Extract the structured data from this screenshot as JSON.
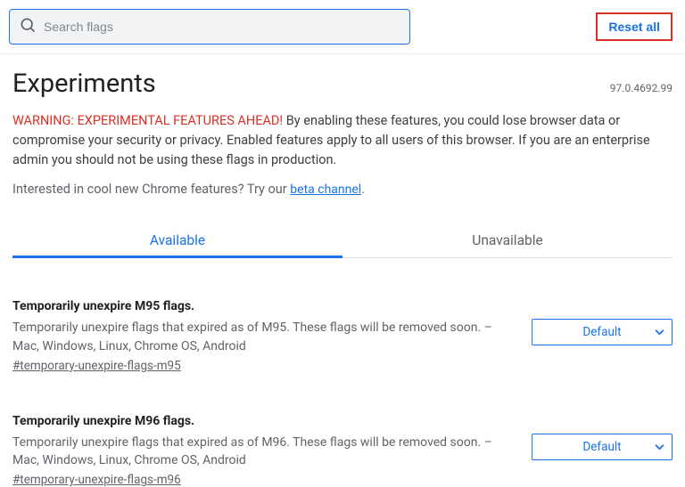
{
  "search": {
    "placeholder": "Search flags"
  },
  "reset_label": "Reset all",
  "header": {
    "title": "Experiments",
    "version": "97.0.4692.99"
  },
  "warning": {
    "head": "WARNING: EXPERIMENTAL FEATURES AHEAD!",
    "body": " By enabling these features, you could lose browser data or compromise your security or privacy. Enabled features apply to all users of this browser. If you are an enterprise admin you should not be using these flags in production."
  },
  "interest": {
    "prefix": "Interested in cool new Chrome features? Try our ",
    "link_text": "beta channel",
    "suffix": "."
  },
  "tabs": {
    "available": "Available",
    "unavailable": "Unavailable"
  },
  "flags": [
    {
      "title": "Temporarily unexpire M95 flags.",
      "desc": "Temporarily unexpire flags that expired as of M95. These flags will be removed soon. – Mac, Windows, Linux, Chrome OS, Android",
      "anchor": "#temporary-unexpire-flags-m95",
      "selected": "Default"
    },
    {
      "title": "Temporarily unexpire M96 flags.",
      "desc": "Temporarily unexpire flags that expired as of M96. These flags will be removed soon. – Mac, Windows, Linux, Chrome OS, Android",
      "anchor": "#temporary-unexpire-flags-m96",
      "selected": "Default"
    }
  ]
}
